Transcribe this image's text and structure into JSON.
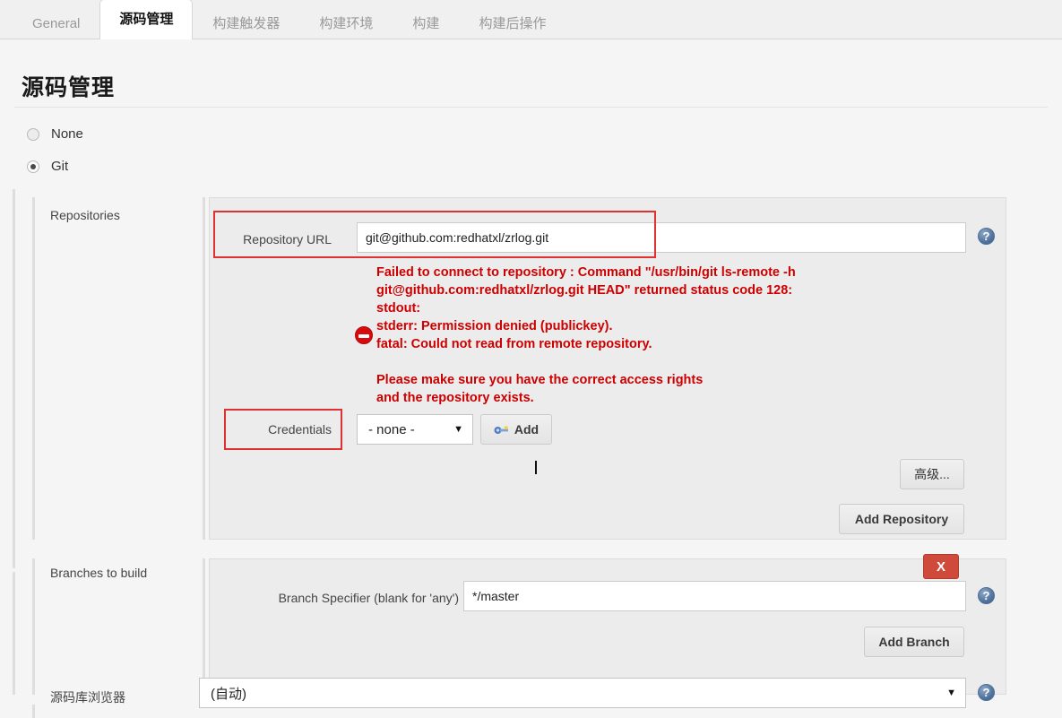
{
  "tabs": [
    {
      "label": "General",
      "active": false
    },
    {
      "label": "源码管理",
      "active": true
    },
    {
      "label": "构建触发器",
      "active": false
    },
    {
      "label": "构建环境",
      "active": false
    },
    {
      "label": "构建",
      "active": false
    },
    {
      "label": "构建后操作",
      "active": false
    }
  ],
  "section": {
    "title": "源码管理"
  },
  "scm_options": [
    {
      "label": "None",
      "selected": false
    },
    {
      "label": "Git",
      "selected": true
    }
  ],
  "repositories": {
    "row_label": "Repositories",
    "repository_url": {
      "label": "Repository URL",
      "value": "git@github.com:redhatxl/zrlog.git"
    },
    "error": {
      "text": "Failed to connect to repository : Command \"/usr/bin/git ls-remote -h\ngit@github.com:redhatxl/zrlog.git HEAD\" returned status code 128:\nstdout:\nstderr: Permission denied (publickey).\nfatal: Could not read from remote repository.\n\nPlease make sure you have the correct access rights\nand the repository exists.",
      "color": "#cc0000",
      "icon": "error-deny-icon"
    },
    "credentials": {
      "label": "Credentials",
      "selected": "- none -",
      "add_button": "Add",
      "add_button_icon": "key-icon"
    },
    "advanced_button": "高级...",
    "add_repository_button": "Add Repository"
  },
  "branches": {
    "row_label": "Branches to build",
    "delete_button": "X",
    "branch_specifier": {
      "label": "Branch Specifier (blank for 'any')",
      "value": "*/master"
    },
    "add_branch_button": "Add Branch"
  },
  "repository_browser": {
    "row_label": "源码库浏览器",
    "selected": "(自动)"
  },
  "help_icon_glyph": "?",
  "colors": {
    "error_red": "#cc0000",
    "annotation_red": "#e03030",
    "delete_red": "#d04a3b",
    "panel_bg": "#ececec",
    "page_bg": "#f5f5f5"
  }
}
